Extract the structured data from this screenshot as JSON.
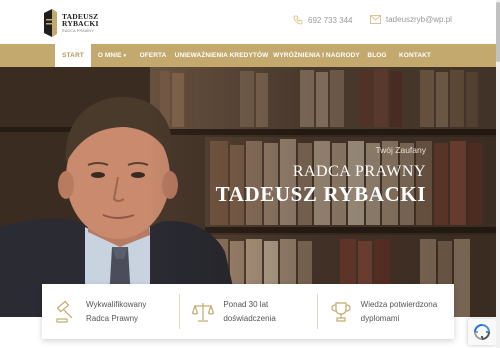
{
  "logo": {
    "name_line1": "TADEUSZ",
    "name_line2": "RYBACKI",
    "subtitle": "RADCA PRAWNY"
  },
  "contact": {
    "phone": "692 733 344",
    "email": "tadeuszryb@wp.pl"
  },
  "nav": {
    "items": [
      {
        "label": "START",
        "active": true
      },
      {
        "label": "O MNIE",
        "has_caret": true
      },
      {
        "label": "OFERTA"
      },
      {
        "label": "UNIEWAŻNIENIA KREDYTÓW"
      },
      {
        "label": "WYRÓŻNIENIA I NAGRODY"
      },
      {
        "label": "BLOG"
      },
      {
        "label": "KONTAKT"
      }
    ],
    "caret": "▾"
  },
  "hero": {
    "tagline": "Twój Zaufany",
    "title_line1": "RADCA PRAWNY",
    "title_line2": "TADEUSZ RYBACKI"
  },
  "features": [
    {
      "icon": "gavel-icon",
      "line1": "Wykwalifikowany",
      "line2": "Radca Prawny"
    },
    {
      "icon": "scales-icon",
      "line1": "Ponad 30 lat",
      "line2": "doświadczenia"
    },
    {
      "icon": "trophy-icon",
      "line1": "Wiedza potwierdzona",
      "line2": "dyplomami"
    }
  ],
  "colors": {
    "accent": "#c3a96e",
    "accent_text": "#b8965a"
  }
}
